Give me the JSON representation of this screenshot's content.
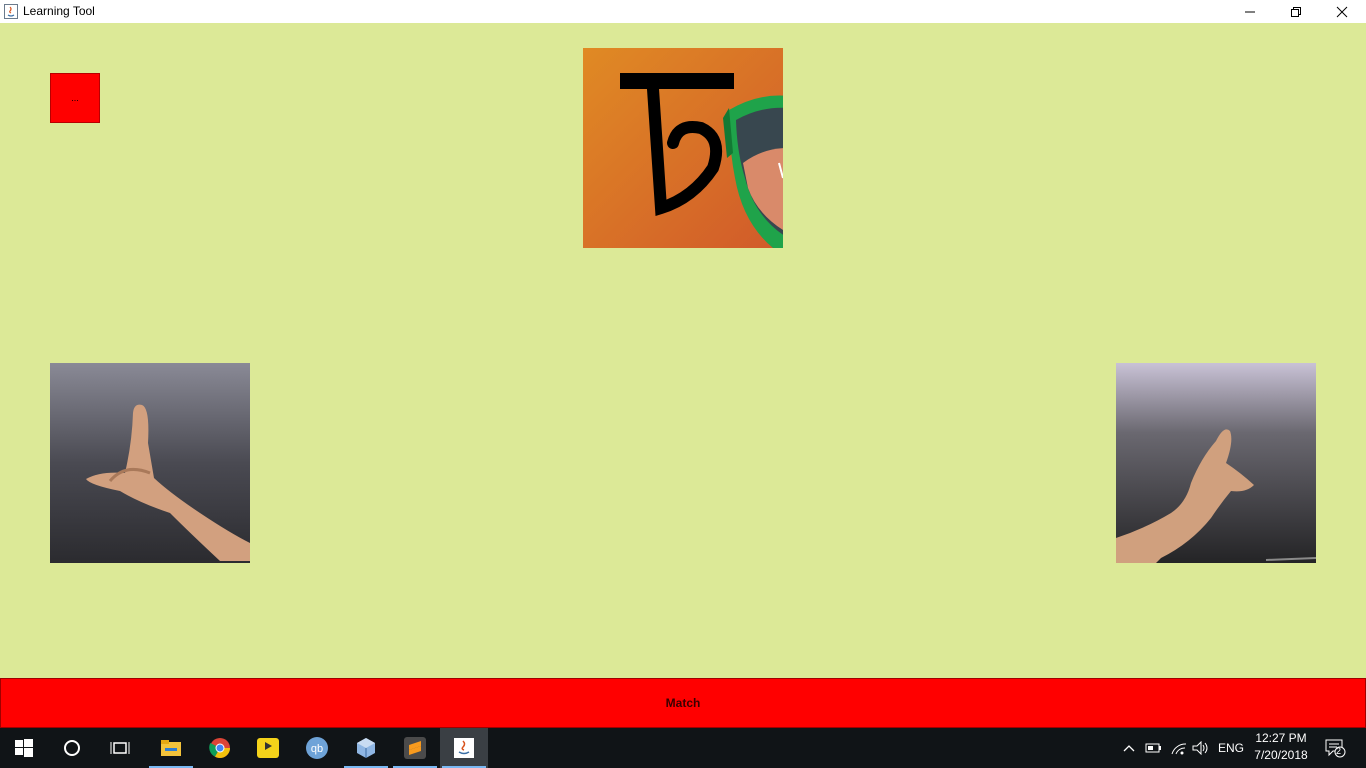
{
  "window": {
    "title": "Learning Tool",
    "controls": [
      "minimize",
      "restore",
      "close"
    ]
  },
  "content": {
    "background_color": "#dce997",
    "small_button_label": "...",
    "letter_image": "Bengali letter ট on orange background with green sunglasses",
    "left_hand_image": "hand sign photo",
    "right_hand_image": "hand sign photo",
    "match_button_label": "Match",
    "accent_color": "#ff0000"
  },
  "taskbar": {
    "apps": [
      "start-icon",
      "cortana-icon",
      "task-view-icon",
      "file-explorer-icon",
      "chrome-icon",
      "player-icon",
      "qbittorrent-icon",
      "virtualbox-icon",
      "sublime-text-icon",
      "java-icon"
    ],
    "language": "ENG",
    "time": "12:27 PM",
    "date": "7/20/2018",
    "notification_count": "2"
  }
}
